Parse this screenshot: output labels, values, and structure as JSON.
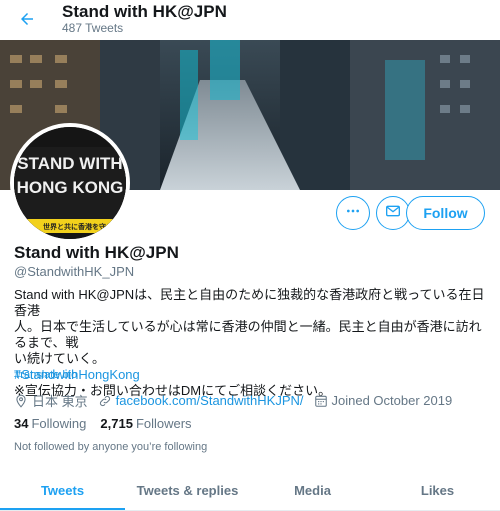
{
  "header": {
    "title": "Stand with HK@JPN",
    "tweet_count": "487 Tweets"
  },
  "avatar": {
    "line1": "STAND WITH",
    "line2": "HONG KONG",
    "strip": "世界と共に香港を守る"
  },
  "actions": {
    "follow_label": "Follow",
    "more_icon": "more-icon",
    "message_icon": "envelope-icon"
  },
  "profile": {
    "name": "Stand with HK@JPN",
    "handle": "@StandwithHK_JPN",
    "bio_line1": "Stand with HK@JPNは、民主と自由のために独裁的な香港政府と戦っている在日香港",
    "bio_line2": "人。日本で生活しているが心は常に香港の仲間と一緒。民主と自由が香港に訪れるまで、戦",
    "bio_line3": "い続けていく。",
    "hashtag": "#StandwithHongKong",
    "bio_line4": "※宣伝協力・お問い合わせはDMにてご相談ください。",
    "translate": "Translate bio",
    "location": "日本 東京",
    "website": "facebook.com/StandwithHKJPN/",
    "joined": "Joined October 2019",
    "following_count": "34",
    "following_label": "Following",
    "followers_count": "2,715",
    "followers_label": "Followers",
    "followed_note": "Not followed by anyone you’re following"
  },
  "tabs": [
    {
      "label": "Tweets",
      "active": true
    },
    {
      "label": "Tweets & replies",
      "active": false
    },
    {
      "label": "Media",
      "active": false
    },
    {
      "label": "Likes",
      "active": false
    }
  ],
  "colors": {
    "accent": "#1da1f2",
    "text": "#14171a",
    "muted": "#657786"
  }
}
